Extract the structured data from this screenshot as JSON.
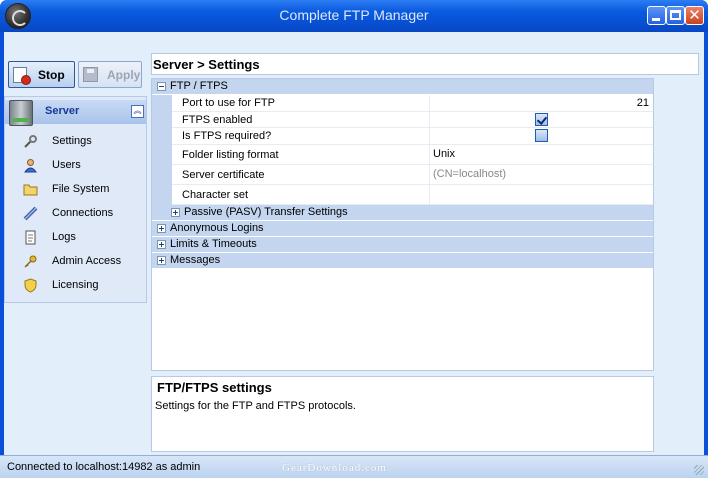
{
  "window": {
    "title": "Complete FTP Manager"
  },
  "toolbar": {
    "stop_label": "Stop",
    "apply_label": "Apply"
  },
  "sidebar": {
    "header": "Server",
    "items": [
      {
        "label": "Settings",
        "icon": "wrench-icon"
      },
      {
        "label": "Users",
        "icon": "user-icon"
      },
      {
        "label": "File System",
        "icon": "folder-icon"
      },
      {
        "label": "Connections",
        "icon": "connection-icon"
      },
      {
        "label": "Logs",
        "icon": "log-icon"
      },
      {
        "label": "Admin Access",
        "icon": "key-icon"
      },
      {
        "label": "Licensing",
        "icon": "shield-icon"
      }
    ]
  },
  "main": {
    "breadcrumb": "Server > Settings",
    "categories": {
      "ftp_ftps": "FTP / FTPS",
      "passive": "Passive (PASV) Transfer Settings",
      "anonymous": "Anonymous Logins",
      "limits": "Limits & Timeouts",
      "messages": "Messages"
    },
    "properties": [
      {
        "name": "Port to use for FTP",
        "value": "21"
      },
      {
        "name": "FTPS enabled",
        "checked": true
      },
      {
        "name": "Is FTPS required?",
        "checked": false
      },
      {
        "name": "Folder listing format",
        "value": "Unix"
      },
      {
        "name": "Server certificate",
        "value": "(CN=localhost)"
      },
      {
        "name": "Character set",
        "value": ""
      }
    ],
    "description": {
      "title": "FTP/FTPS settings",
      "text": "Settings for the FTP and FTPS protocols."
    }
  },
  "statusbar": {
    "text": "Connected to localhost:14982 as admin",
    "watermark": "GearDownload.com"
  }
}
